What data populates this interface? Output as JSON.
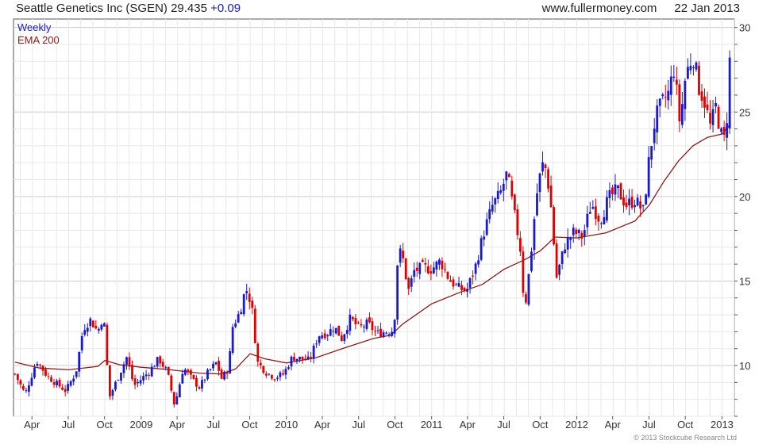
{
  "header": {
    "name": "Seattle Genetics Inc (SGEN)",
    "price": "29.435",
    "change": "+0.09",
    "website": "www.fullermoney.com",
    "date": "22 Jan 2013"
  },
  "legend": {
    "weekly": "Weekly",
    "ema": "EMA 200"
  },
  "copyright": "© 2013 Stockcube Research Ltd",
  "colors": {
    "up": "#1a1acc",
    "down": "#e00000",
    "ema": "#8b1a1a",
    "grid": "#dddddd",
    "frame": "#555555"
  },
  "chart_data": {
    "type": "candlestick",
    "title": "Seattle Genetics Inc (SGEN)",
    "interval": "Weekly",
    "ylim": [
      7,
      30.5
    ],
    "y_ticks": [
      10,
      15,
      20,
      25,
      30
    ],
    "x_range": [
      2008.12,
      2013.085
    ],
    "x_ticks": [
      {
        "label": "Apr",
        "x": 2008.247
      },
      {
        "label": "Jul",
        "x": 2008.497
      },
      {
        "label": "Oct",
        "x": 2008.747
      },
      {
        "label": "2009",
        "x": 2009.0
      },
      {
        "label": "Apr",
        "x": 2009.247
      },
      {
        "label": "Jul",
        "x": 2009.497
      },
      {
        "label": "Oct",
        "x": 2009.747
      },
      {
        "label": "2010",
        "x": 2010.0
      },
      {
        "label": "Apr",
        "x": 2010.247
      },
      {
        "label": "Jul",
        "x": 2010.497
      },
      {
        "label": "Oct",
        "x": 2010.747
      },
      {
        "label": "2011",
        "x": 2011.0
      },
      {
        "label": "Apr",
        "x": 2011.247
      },
      {
        "label": "Jul",
        "x": 2011.497
      },
      {
        "label": "Oct",
        "x": 2011.747
      },
      {
        "label": "2012",
        "x": 2012.0
      },
      {
        "label": "Apr",
        "x": 2012.247
      },
      {
        "label": "Jul",
        "x": 2012.497
      },
      {
        "label": "Oct",
        "x": 2012.747
      },
      {
        "label": "2013",
        "x": 2013.0
      }
    ],
    "price_path": [
      [
        2008.13,
        9.5
      ],
      [
        2008.2,
        8.3
      ],
      [
        2008.28,
        10.3
      ],
      [
        2008.35,
        9.4
      ],
      [
        2008.42,
        8.9
      ],
      [
        2008.48,
        8.5
      ],
      [
        2008.55,
        9.6
      ],
      [
        2008.6,
        12.2
      ],
      [
        2008.65,
        12.7
      ],
      [
        2008.7,
        12.0
      ],
      [
        2008.74,
        13.0
      ],
      [
        2008.78,
        8.1
      ],
      [
        2008.85,
        9.5
      ],
      [
        2008.9,
        10.5
      ],
      [
        2008.95,
        8.8
      ],
      [
        2009.0,
        9.2
      ],
      [
        2009.05,
        9.6
      ],
      [
        2009.12,
        10.4
      ],
      [
        2009.18,
        9.6
      ],
      [
        2009.23,
        7.6
      ],
      [
        2009.29,
        9.9
      ],
      [
        2009.35,
        9.2
      ],
      [
        2009.4,
        8.7
      ],
      [
        2009.46,
        9.6
      ],
      [
        2009.52,
        10.2
      ],
      [
        2009.55,
        9.2
      ],
      [
        2009.6,
        9.8
      ],
      [
        2009.63,
        12.3
      ],
      [
        2009.68,
        13.2
      ],
      [
        2009.72,
        14.6
      ],
      [
        2009.76,
        13.6
      ],
      [
        2009.8,
        10.2
      ],
      [
        2009.86,
        9.6
      ],
      [
        2009.92,
        9.3
      ],
      [
        2009.98,
        9.5
      ],
      [
        2010.04,
        10.5
      ],
      [
        2010.1,
        10.4
      ],
      [
        2010.16,
        10.3
      ],
      [
        2010.22,
        11.8
      ],
      [
        2010.28,
        11.9
      ],
      [
        2010.33,
        12.3
      ],
      [
        2010.38,
        11.6
      ],
      [
        2010.44,
        12.8
      ],
      [
        2010.5,
        12.2
      ],
      [
        2010.56,
        12.5
      ],
      [
        2010.62,
        11.9
      ],
      [
        2010.68,
        12.0
      ],
      [
        2010.74,
        12.1
      ],
      [
        2010.77,
        16.9
      ],
      [
        2010.8,
        16.4
      ],
      [
        2010.84,
        14.4
      ],
      [
        2010.88,
        15.6
      ],
      [
        2010.94,
        15.8
      ],
      [
        2011.0,
        15.7
      ],
      [
        2011.06,
        16.2
      ],
      [
        2011.12,
        15.1
      ],
      [
        2011.18,
        14.6
      ],
      [
        2011.24,
        14.4
      ],
      [
        2011.3,
        15.8
      ],
      [
        2011.36,
        17.9
      ],
      [
        2011.42,
        19.5
      ],
      [
        2011.47,
        20.1
      ],
      [
        2011.52,
        21.4
      ],
      [
        2011.56,
        19.4
      ],
      [
        2011.61,
        17.0
      ],
      [
        2011.64,
        13.2
      ],
      [
        2011.68,
        16.2
      ],
      [
        2011.72,
        19.9
      ],
      [
        2011.76,
        21.9
      ],
      [
        2011.79,
        21.6
      ],
      [
        2011.82,
        19.6
      ],
      [
        2011.86,
        15.2
      ],
      [
        2011.92,
        17.2
      ],
      [
        2011.98,
        17.9
      ],
      [
        2012.04,
        17.6
      ],
      [
        2012.1,
        19.6
      ],
      [
        2012.16,
        18.6
      ],
      [
        2012.22,
        19.9
      ],
      [
        2012.28,
        20.4
      ],
      [
        2012.34,
        19.5
      ],
      [
        2012.4,
        19.8
      ],
      [
        2012.46,
        19.1
      ],
      [
        2012.5,
        22.4
      ],
      [
        2012.54,
        24.6
      ],
      [
        2012.58,
        25.4
      ],
      [
        2012.63,
        26.1
      ],
      [
        2012.67,
        27.6
      ],
      [
        2012.71,
        24.3
      ],
      [
        2012.75,
        27.2
      ],
      [
        2012.8,
        28.4
      ],
      [
        2012.84,
        26.5
      ],
      [
        2012.88,
        25.6
      ],
      [
        2012.92,
        24.1
      ],
      [
        2012.96,
        25.4
      ],
      [
        2012.99,
        23.7
      ],
      [
        2013.02,
        23.3
      ],
      [
        2013.04,
        25.4
      ],
      [
        2013.06,
        29.4
      ]
    ],
    "ema200": [
      [
        2008.13,
        10.2
      ],
      [
        2008.3,
        9.85
      ],
      [
        2008.5,
        9.75
      ],
      [
        2008.7,
        9.95
      ],
      [
        2008.75,
        10.3
      ],
      [
        2008.85,
        10.05
      ],
      [
        2009.0,
        9.9
      ],
      [
        2009.2,
        9.75
      ],
      [
        2009.4,
        9.55
      ],
      [
        2009.55,
        9.5
      ],
      [
        2009.65,
        9.8
      ],
      [
        2009.75,
        10.7
      ],
      [
        2009.85,
        10.4
      ],
      [
        2010.0,
        10.15
      ],
      [
        2010.2,
        10.45
      ],
      [
        2010.4,
        11.05
      ],
      [
        2010.6,
        11.6
      ],
      [
        2010.72,
        11.8
      ],
      [
        2010.8,
        12.45
      ],
      [
        2011.0,
        13.65
      ],
      [
        2011.2,
        14.35
      ],
      [
        2011.35,
        14.8
      ],
      [
        2011.5,
        15.7
      ],
      [
        2011.65,
        16.3
      ],
      [
        2011.75,
        16.8
      ],
      [
        2011.85,
        17.6
      ],
      [
        2012.0,
        17.55
      ],
      [
        2012.2,
        17.85
      ],
      [
        2012.4,
        18.55
      ],
      [
        2012.5,
        19.5
      ],
      [
        2012.6,
        20.9
      ],
      [
        2012.7,
        22.1
      ],
      [
        2012.8,
        23.0
      ],
      [
        2012.9,
        23.5
      ],
      [
        2013.0,
        23.7
      ],
      [
        2013.06,
        24.3
      ]
    ]
  }
}
